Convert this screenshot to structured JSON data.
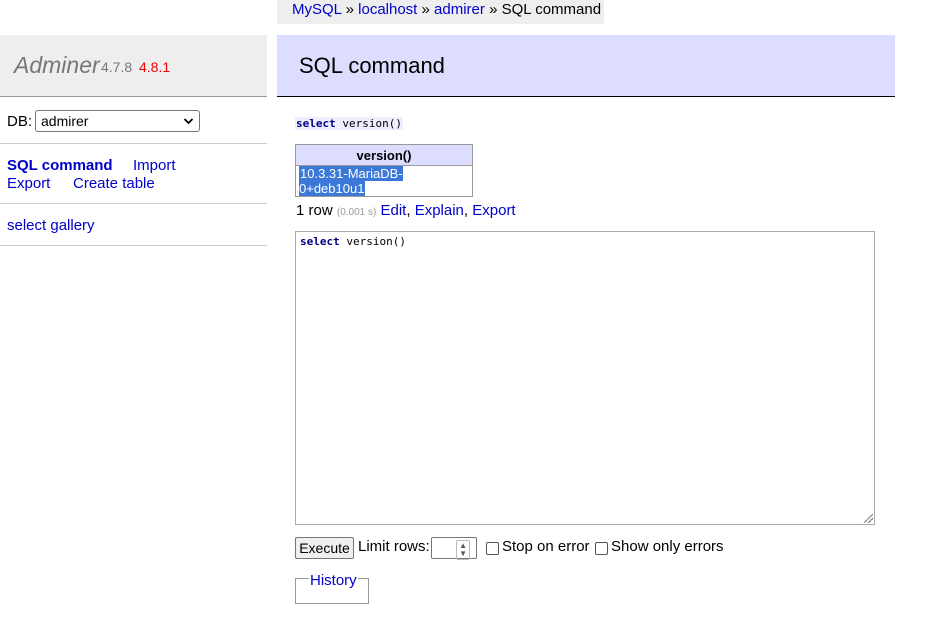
{
  "breadcrumb": {
    "items": [
      "MySQL",
      "localhost",
      "admirer"
    ],
    "separator": "»",
    "current": "SQL command"
  },
  "app": {
    "name": "Adminer",
    "version_current": "4.7.8",
    "version_new": "4.8.1"
  },
  "sidebar": {
    "db_label": "DB:",
    "db_selected": "admirer",
    "links": {
      "sql_command": "SQL command",
      "import": "Import",
      "export": "Export",
      "create_table": "Create table"
    },
    "gallery": "select gallery"
  },
  "main": {
    "title": "SQL command",
    "query_keyword": "select",
    "query_fn": "version()",
    "result": {
      "column": "version()",
      "value": "10.3.31-MariaDB-0+deb10u1"
    },
    "row_count": "1 row",
    "time": "(0.001 s)",
    "actions": [
      "Edit",
      "Explain",
      "Export"
    ],
    "editor_keyword": "select",
    "editor_fn": "version()",
    "execute_label": "Execute",
    "limit_label": "Limit rows:",
    "stop_on_error_label": "Stop on error",
    "only_errors_label": "Show only errors",
    "history_label": "History"
  },
  "colors": {
    "link": "#0000cc",
    "version_new": "#ee0000",
    "header_bg": "#ddddff",
    "sidebar_bg": "#eeeeee"
  }
}
